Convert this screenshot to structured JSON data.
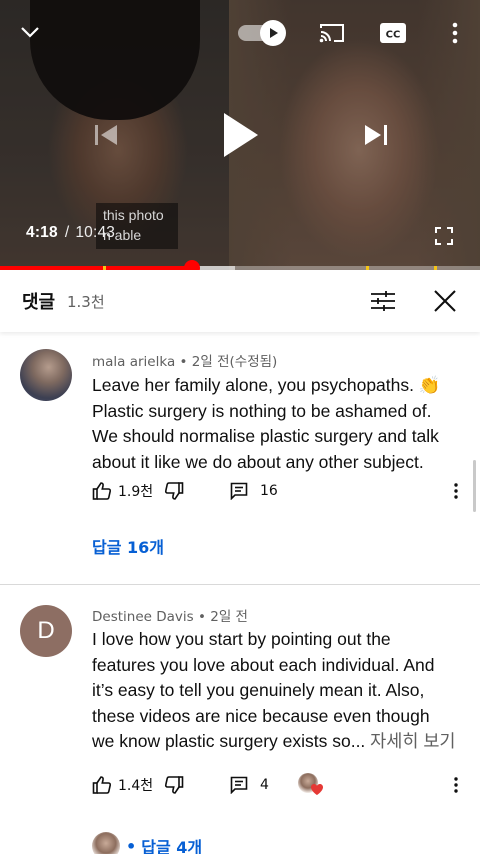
{
  "player": {
    "caption_lines": [
      "this photo",
      "n able"
    ],
    "current_time": "4:18",
    "duration": "10:43",
    "progress_fraction": 0.4,
    "buffered_fraction": 0.49,
    "chapter_marks_fraction": [
      0.215,
      0.762,
      0.905
    ],
    "autoplay_on": true,
    "icons": [
      "chevron-down-icon",
      "autoplay-toggle",
      "cast-icon",
      "cc-icon",
      "more-vert-icon",
      "skip-previous-icon",
      "play-icon",
      "skip-next-icon",
      "fullscreen-icon"
    ]
  },
  "comments_header": {
    "title": "댓글",
    "count": "1.3천"
  },
  "comments": [
    {
      "author": "mala arielka",
      "time": "2일 전(수정됨)",
      "avatar_type": "photo",
      "lines": [
        "Leave her family alone, you psychopaths. 👏",
        "Plastic surgery is nothing to be ashamed of.",
        "We should normalise plastic surgery and talk",
        "about it like we do about any other subject."
      ],
      "likes": "1.9천",
      "reply_count": "16",
      "replies_label": "답글 16개"
    },
    {
      "author": "Destinee Davis",
      "time": "2일 전",
      "avatar_type": "letter",
      "avatar_letter": "D",
      "lines": [
        "I love how you start by pointing out the",
        "features you love about each individual. And",
        "it’s easy to tell you genuinely mean it. Also,",
        "these videos are nice because even though",
        "we know plastic surgery exists so..."
      ],
      "read_more": "자세히 보기",
      "likes": "1.4천",
      "reply_count": "4",
      "replies_label": "답글 4개"
    }
  ],
  "colors": {
    "progress": "#ff0000",
    "link": "#065fd4",
    "chapter_mark": "#f5c518",
    "heart": "#e53935"
  }
}
